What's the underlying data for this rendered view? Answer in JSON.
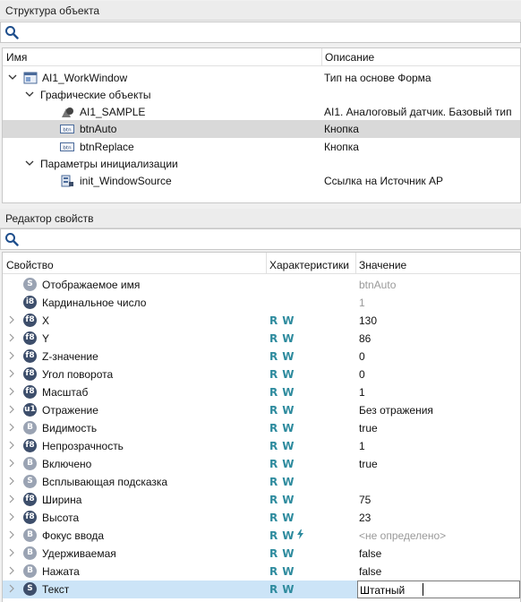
{
  "structure_panel": {
    "title": "Структура объекта",
    "search_placeholder": "",
    "columns": {
      "name": "Имя",
      "description": "Описание"
    },
    "rows": [
      {
        "label": "AI1_WorkWindow",
        "description": "Тип на основе Форма"
      },
      {
        "label": "Графические объекты",
        "description": ""
      },
      {
        "label": "AI1_SAMPLE",
        "description": "AI1. Аналоговый датчик. Базовый тип"
      },
      {
        "label": "btnAuto",
        "description": "Кнопка"
      },
      {
        "label": "btnReplace",
        "description": "Кнопка"
      },
      {
        "label": "Параметры инициализации",
        "description": ""
      },
      {
        "label": "init_WindowSource",
        "description": "Ссылка на Источник АР"
      }
    ]
  },
  "props_panel": {
    "title": "Редактор свойств",
    "search_placeholder": "",
    "columns": {
      "property": "Свойство",
      "characteristics": "Характеристики",
      "value": "Значение"
    },
    "rows": [
      {
        "badge": "S",
        "name": "Отображаемое имя",
        "r": "",
        "w": "",
        "value": "btnAuto",
        "muted": true
      },
      {
        "badge": "i8",
        "name": "Кардинальное число",
        "r": "",
        "w": "",
        "value": "1",
        "muted": true
      },
      {
        "badge": "f8",
        "name": "X",
        "r": "R",
        "w": "W",
        "value": "130"
      },
      {
        "badge": "f8",
        "name": "Y",
        "r": "R",
        "w": "W",
        "value": "86"
      },
      {
        "badge": "f8",
        "name": "Z-значение",
        "r": "R",
        "w": "W",
        "value": "0"
      },
      {
        "badge": "f8",
        "name": "Угол поворота",
        "r": "R",
        "w": "W",
        "value": "0"
      },
      {
        "badge": "f8",
        "name": "Масштаб",
        "r": "R",
        "w": "W",
        "value": "1"
      },
      {
        "badge": "u1",
        "name": "Отражение",
        "r": "R",
        "w": "W",
        "value": "Без отражения"
      },
      {
        "badge": "B",
        "name": "Видимость",
        "r": "R",
        "w": "W",
        "value": "true"
      },
      {
        "badge": "f8",
        "name": "Непрозрачность",
        "r": "R",
        "w": "W",
        "value": "1"
      },
      {
        "badge": "B",
        "name": "Включено",
        "r": "R",
        "w": "W",
        "value": "true"
      },
      {
        "badge": "S",
        "name": "Всплывающая подсказка",
        "r": "R",
        "w": "W",
        "value": ""
      },
      {
        "badge": "f8",
        "name": "Ширина",
        "r": "R",
        "w": "W",
        "value": "75"
      },
      {
        "badge": "f8",
        "name": "Высота",
        "r": "R",
        "w": "W",
        "value": "23"
      },
      {
        "badge": "B",
        "name": "Фокус ввода",
        "r": "R",
        "w": "W",
        "value": "<не определено>",
        "muted": true,
        "bolt": true
      },
      {
        "badge": "B",
        "name": "Удерживаемая",
        "r": "R",
        "w": "W",
        "value": "false"
      },
      {
        "badge": "B",
        "name": "Нажата",
        "r": "R",
        "w": "W",
        "value": "false"
      },
      {
        "badge": "S",
        "name": "Текст",
        "r": "R",
        "w": "W",
        "value": "Штатный",
        "editing": true
      }
    ]
  },
  "colors": {
    "accent_rw": "#2e8b9e",
    "selected_tree": "#d9d9d9",
    "selected_prop": "#cce4f7",
    "badge_dark": "#3d4e6b",
    "badge_light": "#9aa3b3"
  }
}
